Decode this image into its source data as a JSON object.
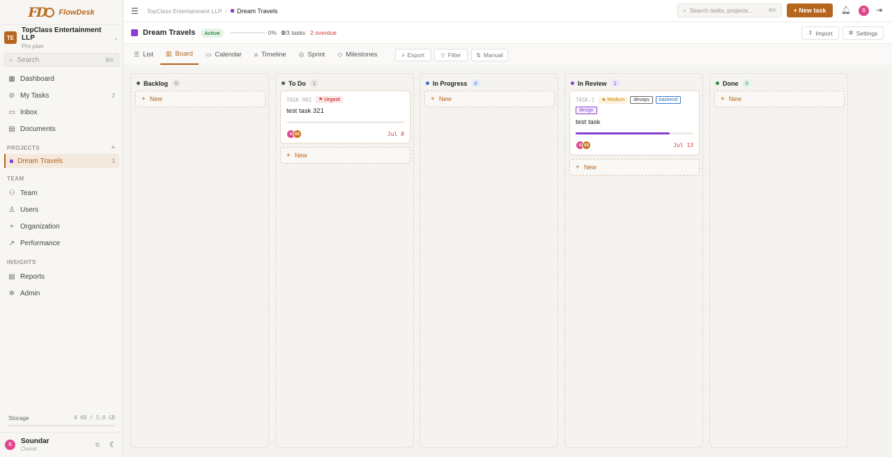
{
  "app": {
    "logo_text": "FlowDesk",
    "logo_mark": "FD"
  },
  "org": {
    "initials": "TE",
    "name": "TopClass Entertainment LLP",
    "plan": "Pro plan"
  },
  "sidebar": {
    "search_placeholder": "Search",
    "search_shortcut": "⌘K",
    "nav": [
      {
        "label": "Dashboard",
        "icon": "dashboard-icon",
        "count": ""
      },
      {
        "label": "My Tasks",
        "icon": "check-circle-icon",
        "count": "2"
      },
      {
        "label": "Inbox",
        "icon": "inbox-icon",
        "count": ""
      },
      {
        "label": "Documents",
        "icon": "document-icon",
        "count": ""
      }
    ],
    "projects_label": "PROJECTS",
    "projects": [
      {
        "label": "Dream Travels",
        "count": "3",
        "color": "#8b3fd0"
      }
    ],
    "team_label": "TEAM",
    "team": [
      {
        "label": "Team",
        "icon": "team-icon"
      },
      {
        "label": "Users",
        "icon": "user-icon"
      },
      {
        "label": "Organization",
        "icon": "organization-icon"
      },
      {
        "label": "Performance",
        "icon": "trend-icon"
      }
    ],
    "insights_label": "INSIGHTS",
    "insights": [
      {
        "label": "Reports",
        "icon": "report-icon"
      },
      {
        "label": "Admin",
        "icon": "admin-gear-icon"
      }
    ],
    "storage": {
      "label": "Storage",
      "value": "0 KB / 5.0 GB",
      "fraction": 0
    },
    "user": {
      "initial": "S",
      "name": "Soundar",
      "role": "Owner"
    }
  },
  "topbar": {
    "crumb_org": "TopClass Entertainment LLP",
    "crumb_sep": "/",
    "crumb_project": "Dream Travels",
    "search_placeholder": "Search tasks, projects...",
    "search_shortcut": "⌘K",
    "new_task_label": "+ New task",
    "avatar_initial": "S"
  },
  "project": {
    "name": "Dream Travels",
    "color": "#8b3fd0",
    "status": "Active",
    "progress_pct": "0%",
    "progress_fraction": 0,
    "tasks_done": "0",
    "tasks_total_text": "/3 tasks",
    "overdue": "2 overdue",
    "import_label": "Import",
    "settings_label": "Settings"
  },
  "tabs": [
    {
      "label": "List",
      "icon": "list-icon"
    },
    {
      "label": "Board",
      "icon": "board-icon"
    },
    {
      "label": "Calendar",
      "icon": "calendar-icon"
    },
    {
      "label": "Timeline",
      "icon": "timeline-icon"
    },
    {
      "label": "Sprint",
      "icon": "sprint-icon"
    },
    {
      "label": "Milestones",
      "icon": "milestone-icon"
    }
  ],
  "active_tab": "Board",
  "tools": {
    "export": "Export",
    "filter": "Filter",
    "sort": "Manual"
  },
  "board": {
    "new_label": "New",
    "columns": [
      {
        "name": "Backlog",
        "count": "0",
        "color": "#555555"
      },
      {
        "name": "To Do",
        "count": "1",
        "color": "#555555"
      },
      {
        "name": "In Progress",
        "count": "0",
        "color": "#3b6fd0"
      },
      {
        "name": "In Review",
        "count": "1",
        "color": "#7a3fd0"
      },
      {
        "name": "Done",
        "count": "0",
        "color": "#2f8a45"
      }
    ],
    "cards": {
      "todo": {
        "id": "TASK-902",
        "priority": "Urgent",
        "title": "test task 321",
        "progress_fraction": 0,
        "avatars": [
          "S",
          "SS"
        ],
        "due": "Jul 8"
      },
      "review": {
        "id": "TASK-1",
        "priority": "Medium",
        "tags": [
          "devops",
          "backend",
          "design"
        ],
        "title": "test task",
        "progress_fraction": 0.8,
        "avatars": [
          "S",
          "SS"
        ],
        "due": "Jul 13"
      }
    }
  }
}
